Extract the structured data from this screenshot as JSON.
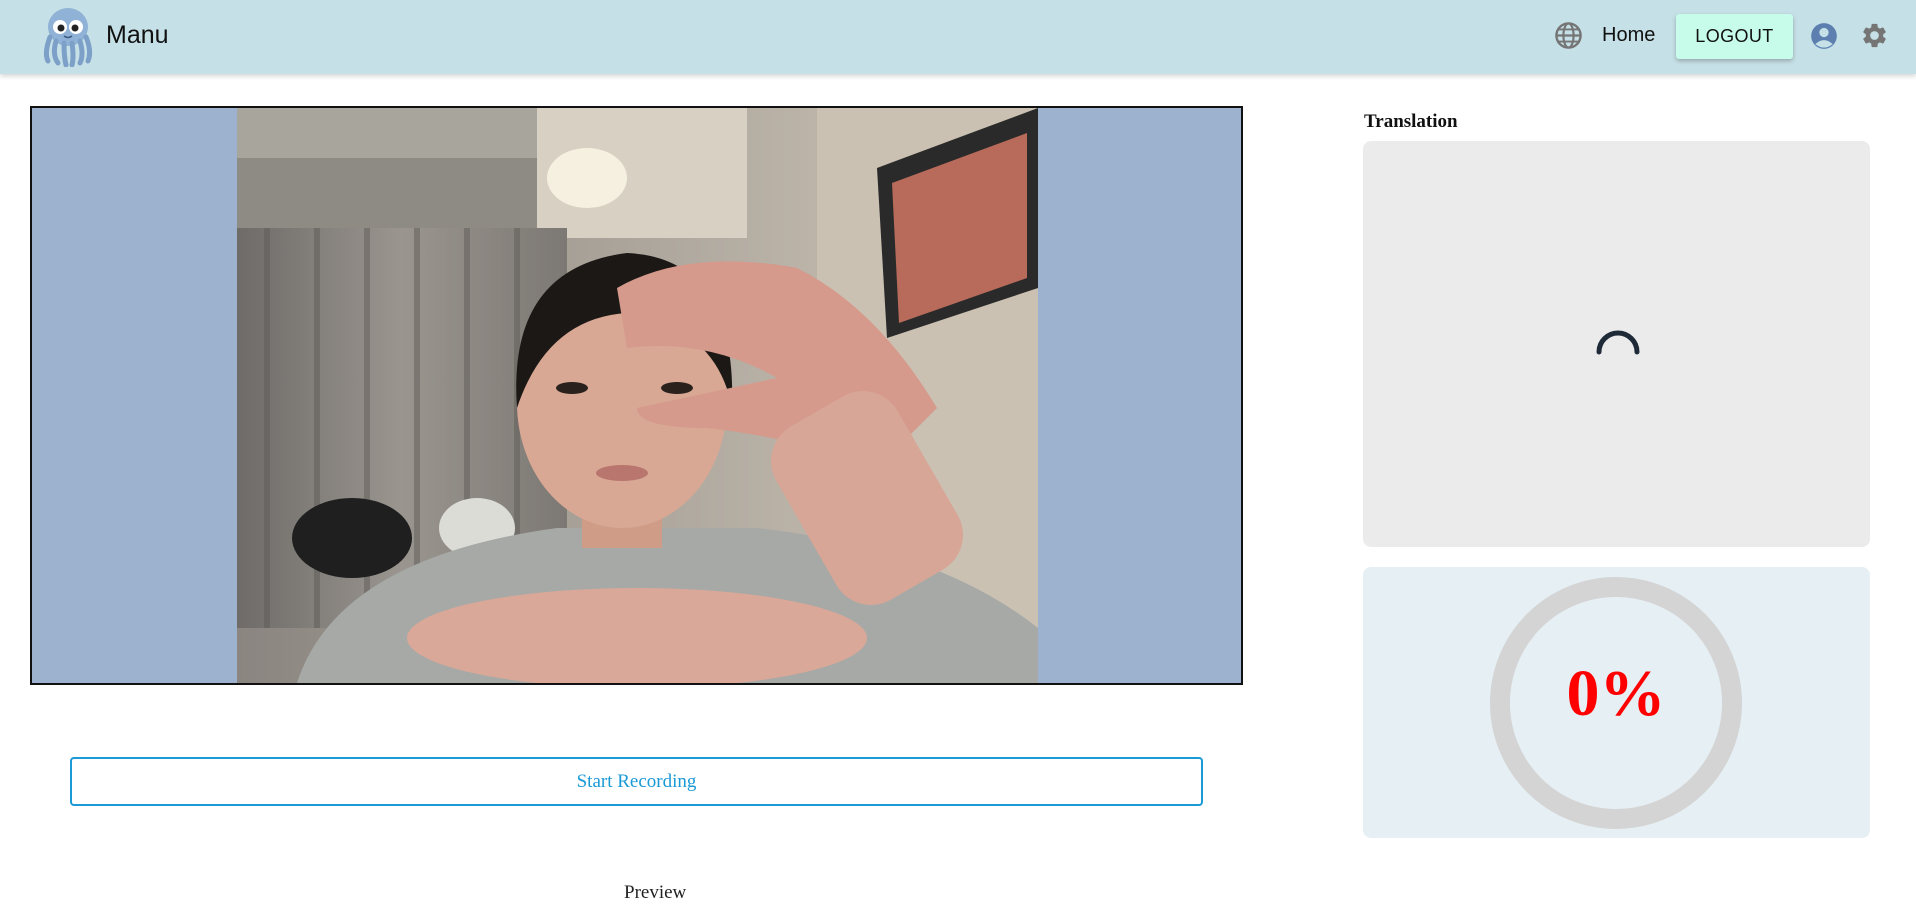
{
  "header": {
    "brand": "Manu",
    "nav_home": "Home",
    "logout_label": "LOGOUT",
    "icons": [
      "octopus-logo",
      "globe-icon",
      "account-icon",
      "gear-icon"
    ]
  },
  "main": {
    "start_button": "Start Recording",
    "preview_label": "Preview"
  },
  "sidebar": {
    "translation_label": "Translation",
    "progress_text": "0%",
    "progress_value": 0
  },
  "colors": {
    "header_bg": "#c5e0e6",
    "logout_bg": "#c6fce9",
    "accent": "#1a9ad6",
    "camera_bg": "#9db2cf",
    "progress_text": "#ff0000"
  }
}
